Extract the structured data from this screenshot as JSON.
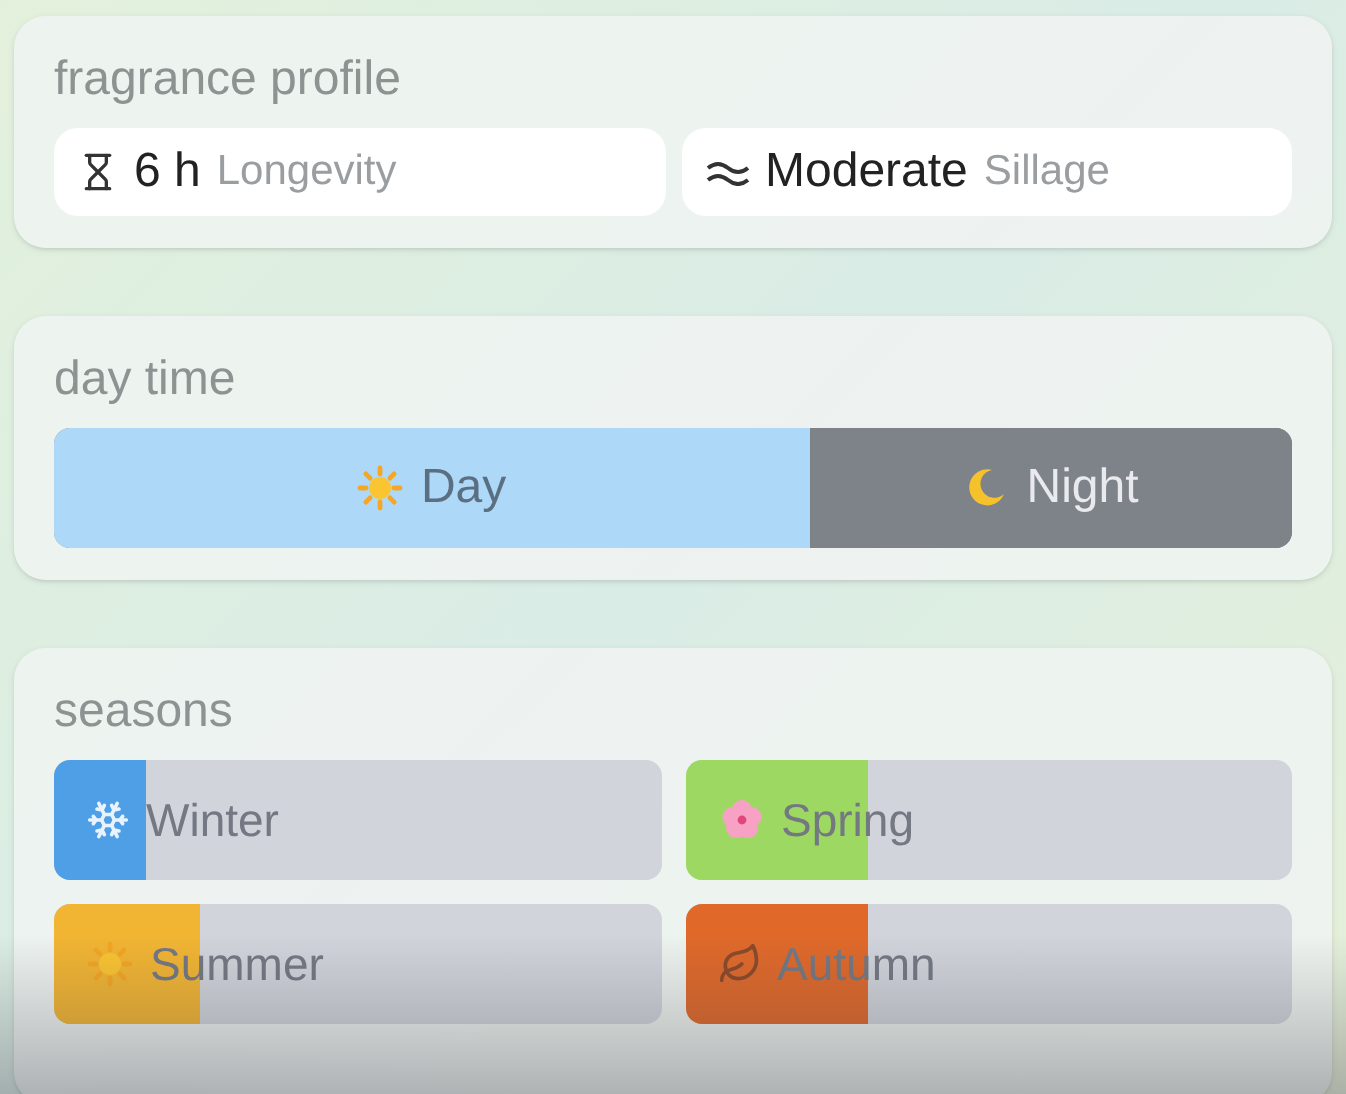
{
  "fragrance_profile": {
    "title": "fragrance profile",
    "stats": [
      {
        "kind": "longevity",
        "value": "6 h",
        "label": "Longevity"
      },
      {
        "kind": "sillage",
        "value": "Moderate",
        "label": "Sillage"
      }
    ]
  },
  "day_time": {
    "title": "day time",
    "segments": [
      {
        "kind": "day",
        "label": "Day",
        "level": 0.61
      },
      {
        "kind": "night",
        "label": "Night"
      }
    ]
  },
  "seasons": {
    "title": "seasons",
    "items": [
      {
        "kind": "winter",
        "label": "Winter",
        "level": 0.15,
        "color": "#4f9fe6"
      },
      {
        "kind": "spring",
        "label": "Spring",
        "level": 0.3,
        "color": "#9dd962"
      },
      {
        "kind": "summer",
        "label": "Summer",
        "level": 0.24,
        "color": "#f2b533"
      },
      {
        "kind": "autumn",
        "label": "Autumn",
        "level": 0.3,
        "color": "#e0692a"
      }
    ]
  }
}
